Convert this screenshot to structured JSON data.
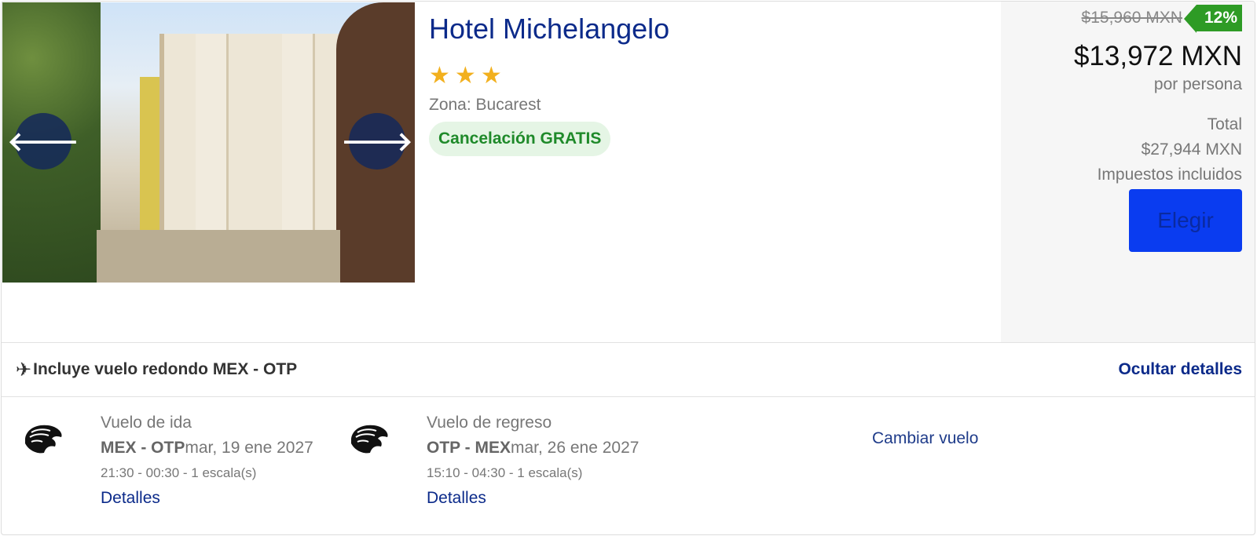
{
  "hotel": {
    "name": "Hotel Michelangelo",
    "stars": 3,
    "zone": "Zona: Bucarest",
    "cancellation": "Cancelación GRATIS"
  },
  "gallery": {
    "prev_icon": "arrow-left-icon",
    "next_icon": "arrow-right-icon",
    "prev_glyph": "🡐",
    "next_glyph": "🡒"
  },
  "pricing": {
    "old_price": "$15,960 MXN",
    "discount": "12%",
    "price": "$13,972 MXN",
    "per_person": "por persona",
    "total_label": "Total",
    "total_value": "$27,944 MXN",
    "taxes": "Impuestos incluidos",
    "choose_label": "Elegir"
  },
  "flight_summary": {
    "label": "Incluye vuelo redondo MEX - OTP",
    "plane_glyph": "✈",
    "toggle_label": "Ocultar detalles"
  },
  "flights": [
    {
      "title": "Vuelo de ida",
      "route": "MEX - OTP",
      "date": "mar, 19 ene 2027",
      "times": "21:30 - 00:30 - 1 escala(s)",
      "details_label": "Detalles"
    },
    {
      "title": "Vuelo de regreso",
      "route": "OTP - MEX",
      "date": "mar, 26 ene 2027",
      "times": "15:10 - 04:30 - 1 escala(s)",
      "details_label": "Detalles"
    }
  ],
  "change_flight_label": "Cambiar vuelo",
  "colors": {
    "brand_blue": "#0b2a8a",
    "button_blue": "#0a3cf0",
    "discount_green": "#2e9b25",
    "star_gold": "#f2b01e"
  }
}
